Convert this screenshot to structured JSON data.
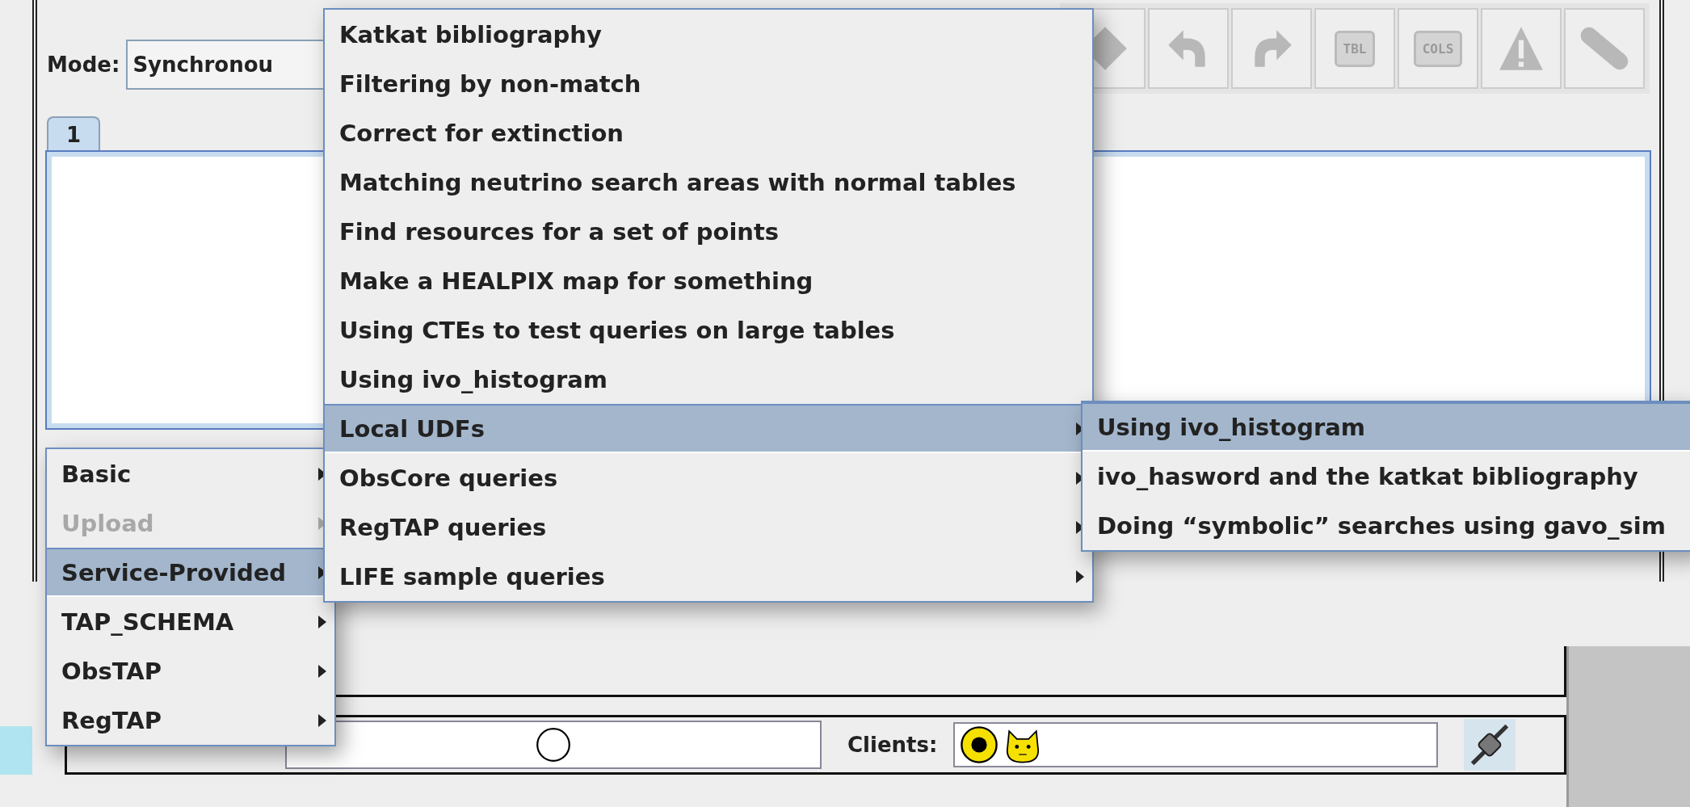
{
  "mode": {
    "label": "Mode:",
    "value": "Synchronou"
  },
  "toolbar": [
    {
      "kind": "diamond",
      "disabled": true
    },
    {
      "kind": "undo",
      "disabled": true
    },
    {
      "kind": "redo",
      "disabled": true
    },
    {
      "kind": "tbl",
      "label": "TBL",
      "disabled": true
    },
    {
      "kind": "cols",
      "label": "COLS",
      "disabled": true
    },
    {
      "kind": "warning",
      "disabled": true
    },
    {
      "kind": "bandage",
      "disabled": true
    }
  ],
  "tabs": [
    {
      "label": "1",
      "selected": true
    }
  ],
  "status": {
    "clients_label": "Clients:"
  },
  "menus": [
    {
      "items": [
        {
          "label": "Basic",
          "submenu": true,
          "selected": false,
          "disabled": false
        },
        {
          "label": "Upload",
          "submenu": true,
          "selected": false,
          "disabled": true
        },
        {
          "label": "Service-Provided",
          "submenu": true,
          "selected": true,
          "disabled": false
        },
        {
          "label": "TAP_SCHEMA",
          "submenu": true,
          "selected": false,
          "disabled": false
        },
        {
          "label": "ObsTAP",
          "submenu": true,
          "selected": false,
          "disabled": false
        },
        {
          "label": "RegTAP",
          "submenu": true,
          "selected": false,
          "disabled": false
        }
      ]
    },
    {
      "items": [
        {
          "label": "Katkat bibliography",
          "submenu": false,
          "selected": false,
          "disabled": false
        },
        {
          "label": "Filtering by non-match",
          "submenu": false,
          "selected": false,
          "disabled": false
        },
        {
          "label": "Correct for extinction",
          "submenu": false,
          "selected": false,
          "disabled": false
        },
        {
          "label": "Matching neutrino search areas with normal tables",
          "submenu": false,
          "selected": false,
          "disabled": false
        },
        {
          "label": "Find resources for a set of points",
          "submenu": false,
          "selected": false,
          "disabled": false
        },
        {
          "label": "Make a HEALPIX map for something",
          "submenu": false,
          "selected": false,
          "disabled": false
        },
        {
          "label": "Using CTEs to test queries on large tables",
          "submenu": false,
          "selected": false,
          "disabled": false
        },
        {
          "label": "Using ivo_histogram",
          "submenu": false,
          "selected": false,
          "disabled": false
        },
        {
          "label": "Local UDFs",
          "submenu": true,
          "selected": true,
          "disabled": false
        },
        {
          "label": "ObsCore queries",
          "submenu": true,
          "selected": false,
          "disabled": false
        },
        {
          "label": "RegTAP queries",
          "submenu": true,
          "selected": false,
          "disabled": false
        },
        {
          "label": "LIFE sample queries",
          "submenu": true,
          "selected": false,
          "disabled": false
        }
      ]
    },
    {
      "items": [
        {
          "label": "Using ivo_histogram",
          "submenu": false,
          "selected": true,
          "disabled": false
        },
        {
          "label": "ivo_hasword and the katkat bibliography",
          "submenu": false,
          "selected": false,
          "disabled": false
        },
        {
          "label": "Doing “symbolic” searches using gavo_sim",
          "submenu": false,
          "selected": false,
          "disabled": false
        }
      ]
    }
  ]
}
